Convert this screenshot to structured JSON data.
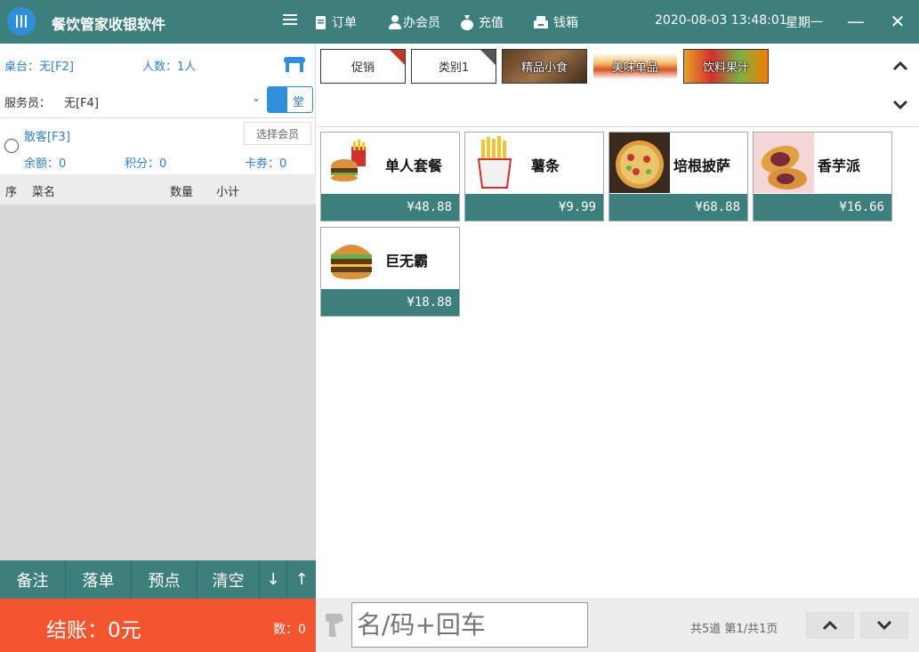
{
  "app": {
    "title": "餐饮管家收银软件"
  },
  "toolbar": {
    "menu_icon": "hamburger-icon",
    "orders": "订单",
    "member": "办会员",
    "recharge": "充值",
    "cashbox": "钱箱",
    "datetime": "2020-08-03 13:48:01",
    "weekday": "星期一"
  },
  "left": {
    "table": "桌台：无[F2]",
    "people": "人数：1人",
    "waiter_label": "服务员：",
    "waiter_value": "无[F4]",
    "dine_mode": "堂",
    "member_name": "散客[F3]",
    "choose_member": "选择会员",
    "balance": "余额：0",
    "points": "积分：0",
    "coupons": "卡券：0",
    "columns": {
      "no": "序",
      "name": "菜名",
      "qty": "数量",
      "subtotal": "小计"
    },
    "actions": {
      "note": "备注",
      "place": "落单",
      "preorder": "预点",
      "clear": "清空",
      "down": "↓",
      "up": "↑"
    },
    "checkout": "结账：0元",
    "count": "数：0"
  },
  "categories": [
    {
      "label": "促销",
      "tag": "促销"
    },
    {
      "label": "类别1",
      "tag": "无图"
    },
    {
      "label": "精品小食"
    },
    {
      "label": "美味单品"
    },
    {
      "label": "饮料果汁"
    }
  ],
  "products": [
    {
      "name": "单人套餐",
      "price": "¥48.88",
      "thumb": "burger-fries-icon"
    },
    {
      "name": "薯条",
      "price": "¥9.99",
      "thumb": "fries-icon"
    },
    {
      "name": "培根披萨",
      "price": "¥68.88",
      "thumb": "pizza-icon"
    },
    {
      "name": "香芋派",
      "price": "¥16.66",
      "thumb": "taro-pie-icon"
    },
    {
      "name": "巨无霸",
      "price": "¥18.88",
      "thumb": "big-burger-icon"
    }
  ],
  "bottom": {
    "search_placeholder": "名/码+回车",
    "total": "共5道",
    "page": "第1/共1页"
  },
  "colors": {
    "teal": "#3d7f7d",
    "orange": "#f2552f",
    "blue": "#2f8fd8"
  }
}
